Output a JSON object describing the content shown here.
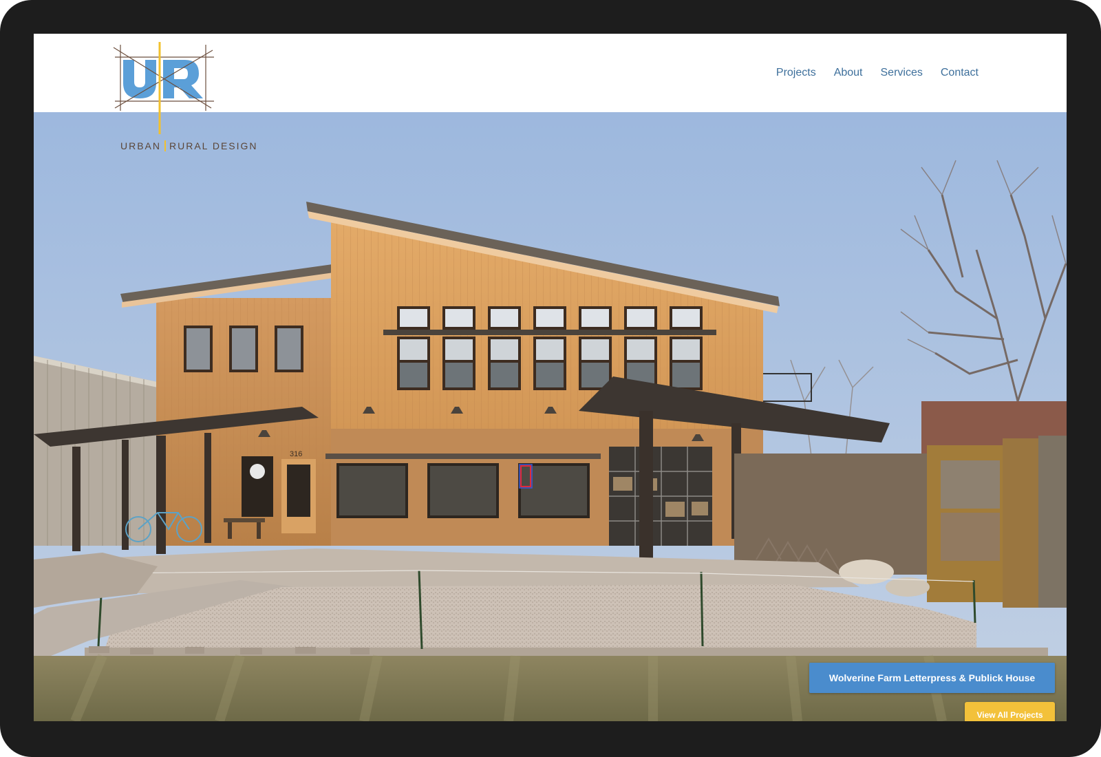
{
  "brand": {
    "logo_letters": "UR",
    "name_left": "URBAN",
    "name_right": "RURAL DESIGN"
  },
  "nav": {
    "items": [
      {
        "label": "Projects"
      },
      {
        "label": "About"
      },
      {
        "label": "Services"
      },
      {
        "label": "Contact"
      }
    ]
  },
  "hero": {
    "caption": "Wolverine Farm Letterpress & Publick House",
    "view_all_label": "View All Projects",
    "building_number": "316"
  },
  "colors": {
    "device_frame": "#1d1d1d",
    "nav_link": "#3d6f9b",
    "logo_blue": "#5b9fd8",
    "logo_accent": "#f2c12e",
    "caption_button": "#4a8ccd",
    "view_all_button": "#f3c13a"
  }
}
